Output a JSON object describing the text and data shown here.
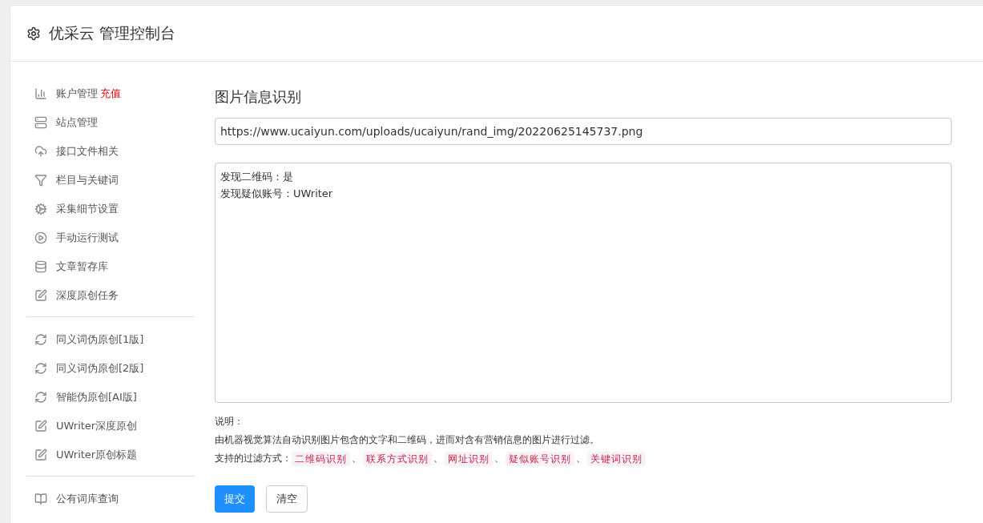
{
  "header": {
    "title": "优采云 管理控制台"
  },
  "sidebar": {
    "groups": [
      {
        "items": [
          {
            "label": "账户管理",
            "badge": "充值"
          },
          {
            "label": "站点管理"
          },
          {
            "label": "接口文件相关"
          },
          {
            "label": "栏目与关键词"
          },
          {
            "label": "采集细节设置"
          },
          {
            "label": "手动运行测试"
          },
          {
            "label": "文章暂存库"
          },
          {
            "label": "深度原创任务"
          }
        ]
      },
      {
        "items": [
          {
            "label": "同义词伪原创[1版]"
          },
          {
            "label": "同义词伪原创[2版]"
          },
          {
            "label": "智能伪原创[AI版]"
          },
          {
            "label": "UWriter深度原创"
          },
          {
            "label": "UWriter原创标题"
          }
        ]
      },
      {
        "items": [
          {
            "label": "公有词库查询"
          }
        ]
      }
    ]
  },
  "main": {
    "title": "图片信息识别",
    "url_field": {
      "value": "https://www.ucaiyun.com/uploads/ucaiyun/rand_img/20220625145737.png"
    },
    "result_box": {
      "lines": [
        "发现二维码：是",
        "发现疑似账号：UWriter"
      ]
    },
    "notes": {
      "heading": "说明：",
      "description": "由机器视觉算法自动识别图片包含的文字和二维码，进而对含有营销信息的图片进行过滤。",
      "methods_label": "支持的过滤方式：",
      "methods": [
        "二维码识别",
        "联系方式识别",
        "网址识别",
        "疑似账号识别",
        "关键词识别"
      ],
      "separator": "、"
    },
    "buttons": [
      {
        "label": "提交",
        "kind": "primary"
      },
      {
        "label": "清空",
        "kind": "default"
      }
    ]
  }
}
